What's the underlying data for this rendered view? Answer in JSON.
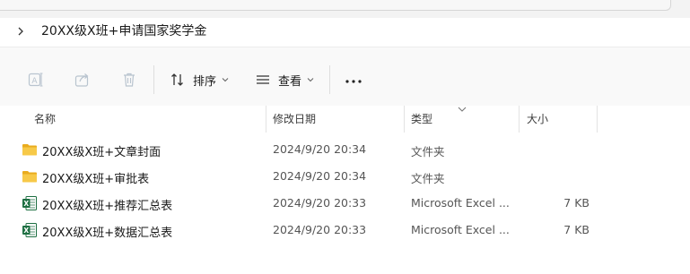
{
  "address": {
    "path": "20XX级X班+申请国家奖学金"
  },
  "toolbar": {
    "sort_label": "排序",
    "view_label": "查看"
  },
  "columns": {
    "name": "名称",
    "modified": "修改日期",
    "type": "类型",
    "size": "大小"
  },
  "files": [
    {
      "name": "20XX级X班+文章封面",
      "modified": "2024/9/20 20:34",
      "type": "文件夹",
      "size": "",
      "icon": "folder-icon"
    },
    {
      "name": "20XX级X班+审批表",
      "modified": "2024/9/20 20:34",
      "type": "文件夹",
      "size": "",
      "icon": "folder-icon"
    },
    {
      "name": "20XX级X班+推荐汇总表",
      "modified": "2024/9/20 20:33",
      "type": "Microsoft Excel ...",
      "size": "7 KB",
      "icon": "excel-icon"
    },
    {
      "name": "20XX级X班+数据汇总表",
      "modified": "2024/9/20 20:33",
      "type": "Microsoft Excel ...",
      "size": "7 KB",
      "icon": "excel-icon"
    }
  ],
  "colors": {
    "folder": "#f7c948",
    "folder_dark": "#e9ac1e",
    "excel": "#1d6f42",
    "disabled_icon": "#b9c4cf"
  }
}
